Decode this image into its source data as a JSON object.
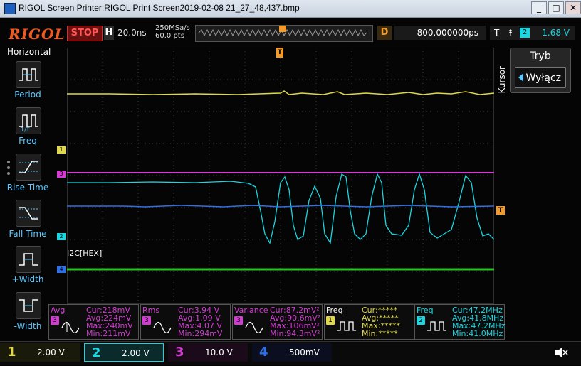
{
  "window": {
    "title": "RIGOL Screen Printer:RIGOL Print Screen2019-02-08 21_27_48,437.bmp",
    "buttons": {
      "minimize": "_",
      "maximize": "□",
      "close": "✕"
    }
  },
  "top_bar": {
    "logo": "RIGOL",
    "run_state": "STOP",
    "horizontal_mode": "H",
    "timebase": "20.0ns",
    "sample_rate": "250MSa/s",
    "memory_depth": "60.0 pts",
    "delay_label": "D",
    "delay_value": "800.000000ps",
    "trigger_label": "T",
    "trigger_edge": "↟",
    "trigger_source": "2",
    "trigger_level": "1.68 V"
  },
  "left_menu": {
    "title": "Horizontal",
    "items": [
      {
        "label": "Period",
        "icon": "period-icon"
      },
      {
        "label": "Freq",
        "icon": "frequency-icon"
      },
      {
        "label": "Rise Time",
        "icon": "rise-time-icon"
      },
      {
        "label": "Fall Time",
        "icon": "fall-time-icon"
      },
      {
        "label": "+Width",
        "icon": "positive-width-icon"
      },
      {
        "label": "-Width",
        "icon": "negative-width-icon"
      }
    ]
  },
  "right_menu": {
    "section": "Kursor",
    "heading": "Tryb",
    "value": "Wyłącz"
  },
  "waveform": {
    "trigger_marker": "T",
    "ch_markers": [
      "1",
      "3",
      "2",
      "4"
    ],
    "decoder_label": "I2C[HEX]",
    "trigger_level_marker": "T",
    "colors": {
      "ch1": "#e0d84a",
      "ch2": "#19d6e0",
      "ch3": "#d23cd2",
      "ch4": "#2f6fe8",
      "decoder": "#22c422",
      "trigger": "#f29b2b"
    }
  },
  "measurements": [
    {
      "name": "Avg",
      "source": "3",
      "color": "#d23cd2",
      "lines": [
        "Cur:218mV",
        "Avg:224mV",
        "Max:240mV",
        "Min:211mV"
      ]
    },
    {
      "name": "Rms",
      "source": "3",
      "color": "#d23cd2",
      "lines": [
        "Cur:3.94 V",
        "Avg:1.09 V",
        "Max:4.07 V",
        "Min:294mV"
      ]
    },
    {
      "name": "Variance",
      "source": "3",
      "color": "#d23cd2",
      "lines": [
        "Cur:87.2mV²",
        "Avg:90.6mV²",
        "Max:106mV²",
        "Min:94.3mV²"
      ]
    },
    {
      "name": "Freq",
      "source": "1",
      "color": "#e0d84a",
      "lines": [
        "Cur:*****",
        "Avg:*****",
        "Max:*****",
        "Min:*****"
      ]
    },
    {
      "name": "Freq",
      "source": "2",
      "color": "#19d6e0",
      "lines": [
        "Cur:47.2MHz",
        "Avg:41.8MHz",
        "Max:47.2MHz",
        "Min:41.0MHz"
      ]
    }
  ],
  "channels": [
    {
      "num": "1",
      "scale": "2.00 V",
      "color": "#e0d84a"
    },
    {
      "num": "2",
      "scale": "2.00 V",
      "color": "#19d6e0"
    },
    {
      "num": "3",
      "scale": "10.0 V",
      "color": "#d23cd2"
    },
    {
      "num": "4",
      "scale": "500mV",
      "color": "#2f6fe8"
    }
  ],
  "speaker_icon": "speaker-muted-icon"
}
